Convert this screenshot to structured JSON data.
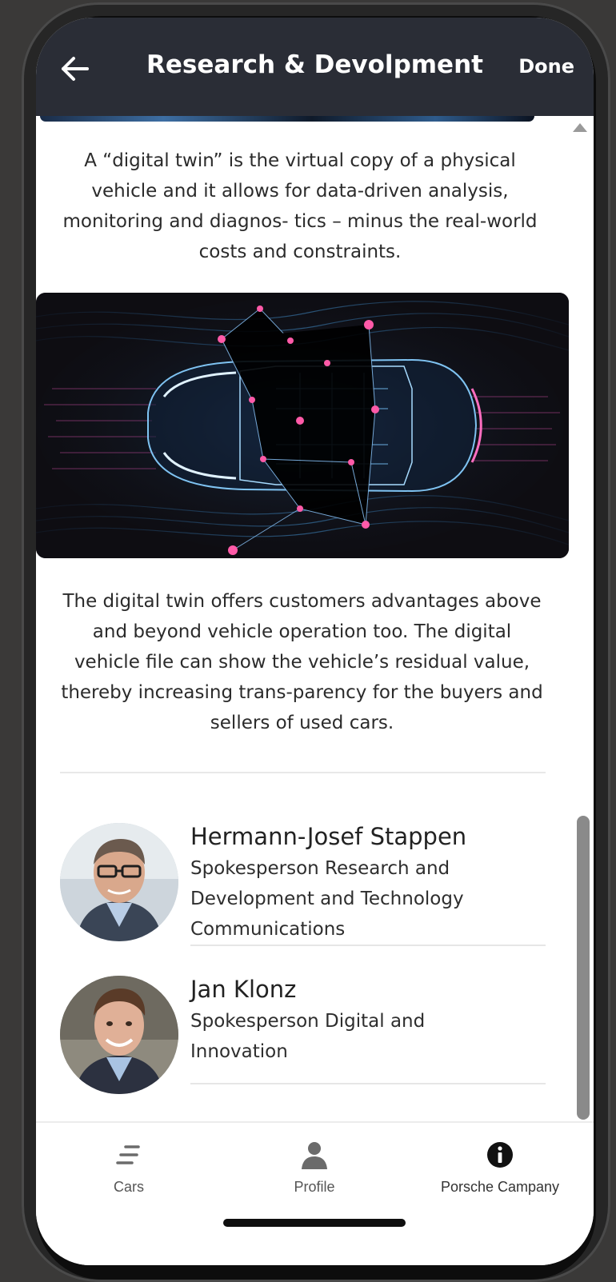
{
  "header": {
    "title": "Research & Devolpment",
    "done_label": "Done",
    "back_icon": "arrow-left-icon",
    "background": "#2a2d36"
  },
  "content": {
    "paragraph1": "A “digital twin” is the virtual copy of a physical vehicle and it allows for data-driven analysis, monitoring and diagnos- tics – minus the real-world costs and constraints.",
    "hero_image": "digital-twin-car-wireframe",
    "paragraph2": "The digital twin offers customers advantages above and beyond vehicle operation too. The digital vehicle file can show the vehicle’s residual value, thereby increasing trans-parency for the buyers and sellers of used cars."
  },
  "contacts": [
    {
      "name": "Hermann-Josef Stappen",
      "role": "Spokesperson Research and Development and Technology Communications"
    },
    {
      "name": "Jan Klonz",
      "role": "Spokesperson Digital and Innovation"
    }
  ],
  "tabbar": {
    "items": [
      {
        "label": "Cars",
        "icon": "list-lines-icon"
      },
      {
        "label": "Profile",
        "icon": "user-icon"
      },
      {
        "label": "Porsche Campany",
        "icon": "info-icon"
      }
    ]
  },
  "colors": {
    "header_bg": "#2a2d36",
    "text": "#2b2b2b",
    "scrollbar": "#8a8a8a",
    "hero_accent": "#ff5aa8"
  }
}
